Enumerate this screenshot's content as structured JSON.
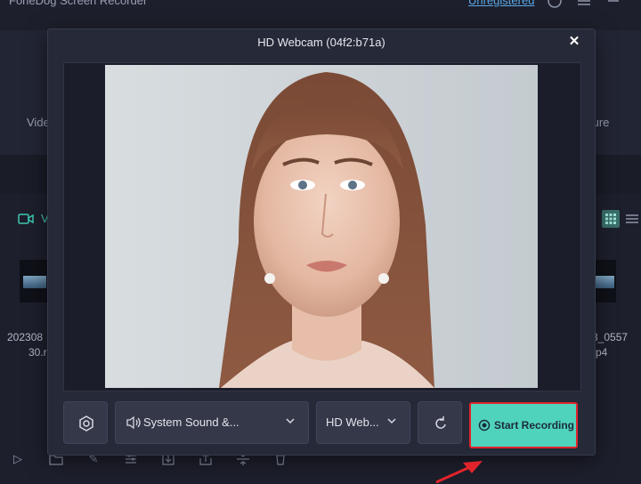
{
  "app": {
    "title": "FoneDog Screen Recorder",
    "unregistered": "Unregistered",
    "tab_left": "Vide",
    "tab_right": "ture",
    "section_label": "V",
    "files": [
      {
        "line1": "202308",
        "line2": "30.r"
      },
      {
        "line1": "3_0557",
        "line2": "p4"
      }
    ]
  },
  "dialog": {
    "title": "HD Webcam (04f2:b71a)",
    "close": "✕"
  },
  "controls": {
    "audio_label": "System Sound &...",
    "camera_label": "HD Web...",
    "start_label": "Start Recording"
  },
  "colors": {
    "accent": "#4fd3bd",
    "highlight": "#e0242b",
    "link": "#5aa9e6"
  }
}
